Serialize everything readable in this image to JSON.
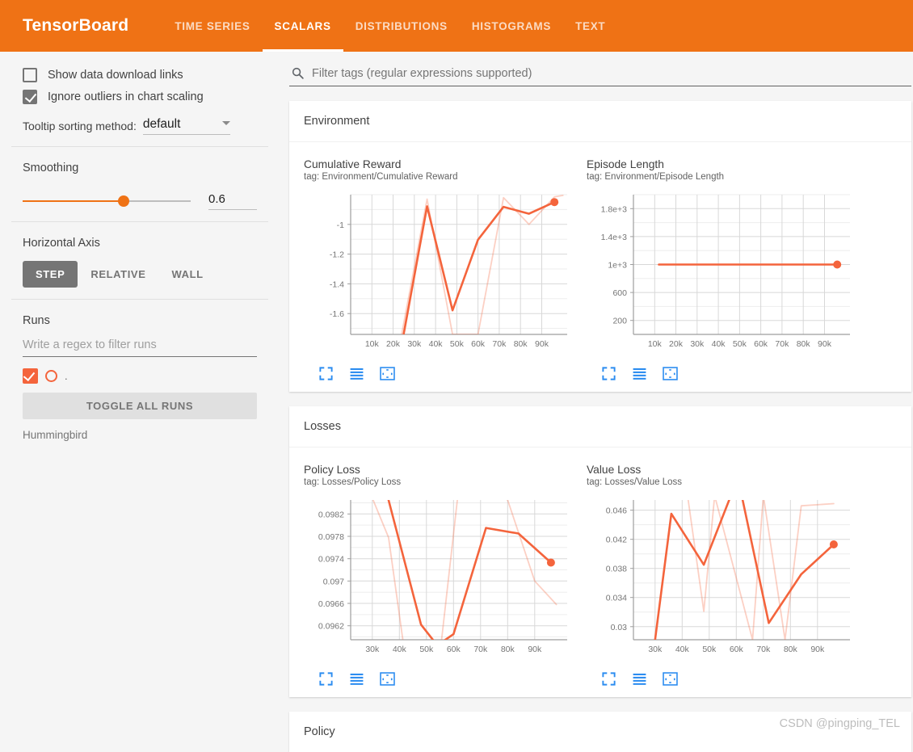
{
  "header": {
    "brand": "TensorBoard",
    "brand_color": "#ef7215",
    "tabs": [
      {
        "label": "TIME SERIES",
        "active": false
      },
      {
        "label": "SCALARS",
        "active": true
      },
      {
        "label": "DISTRIBUTIONS",
        "active": false
      },
      {
        "label": "HISTOGRAMS",
        "active": false
      },
      {
        "label": "TEXT",
        "active": false
      }
    ]
  },
  "sidebar": {
    "checkboxes": [
      {
        "label": "Show data download links",
        "checked": false
      },
      {
        "label": "Ignore outliers in chart scaling",
        "checked": true
      }
    ],
    "tooltip": {
      "label": "Tooltip sorting method:",
      "value": "default",
      "icon": "chevron-down-icon"
    },
    "smoothing": {
      "title": "Smoothing",
      "value": "0.6",
      "slider_percent": 60
    },
    "horizontal_axis": {
      "title": "Horizontal Axis",
      "options": [
        {
          "label": "STEP",
          "active": true
        },
        {
          "label": "RELATIVE",
          "active": false
        },
        {
          "label": "WALL",
          "active": false
        }
      ]
    },
    "runs": {
      "title": "Runs",
      "filter_placeholder": "Write a regex to filter runs",
      "run_color": "#f4643c",
      "dot_label": ".",
      "toggle_all_label": "TOGGLE ALL RUNS",
      "run_name": "Hummingbird"
    }
  },
  "main": {
    "tag_filter": {
      "placeholder": "Filter tags (regular expressions supported)",
      "icon": "search-icon"
    },
    "sections": [
      {
        "title": "Environment"
      },
      {
        "title": "Losses"
      },
      {
        "title": "Policy"
      }
    ],
    "chart_icons": [
      {
        "name": "expand-chart-icon",
        "title": "Fit domain to data"
      },
      {
        "name": "data-table-icon",
        "title": "Toggle data series"
      },
      {
        "name": "fit-domain-icon",
        "title": "Fullscreen"
      }
    ],
    "icon_color": "#2b8cf0"
  },
  "watermark": "CSDN @pingping_TEL",
  "chart_data": [
    {
      "type": "line",
      "title": "Cumulative Reward",
      "tag": "tag: Environment/Cumulative Reward",
      "xlabel": "",
      "ylabel": "",
      "grid": true,
      "legend": "none",
      "xlim": [
        0,
        102000
      ],
      "ylim": [
        -1.74,
        -0.8
      ],
      "xticks": [
        10000,
        20000,
        30000,
        40000,
        50000,
        60000,
        70000,
        80000,
        90000
      ],
      "xticklabels": [
        "10k",
        "20k",
        "30k",
        "40k",
        "50k",
        "60k",
        "70k",
        "80k",
        "90k"
      ],
      "yticks": [
        -1,
        -1.2,
        -1.4,
        -1.6
      ],
      "yticklabels": [
        "-1",
        "-1.2",
        "-1.4",
        "-1.6"
      ],
      "series": [
        {
          "name": "Hummingbird (smoothed)",
          "color": "#f4643c",
          "opacity": 1,
          "marker_last": true,
          "x": [
            25000,
            36000,
            48000,
            60000,
            72000,
            84000,
            96000
          ],
          "y": [
            -1.735,
            -0.878,
            -1.578,
            -1.103,
            -0.882,
            -0.928,
            -0.85
          ]
        },
        {
          "name": "Hummingbird (raw)",
          "color": "#f4643c",
          "opacity": 0.3,
          "marker_last": false,
          "x": [
            24000,
            36000,
            48000,
            60000,
            72000,
            84000,
            96000,
            100000
          ],
          "y": [
            -1.74,
            -0.83,
            -1.74,
            -1.74,
            -0.82,
            -1.0,
            -0.815,
            -0.805
          ]
        }
      ]
    },
    {
      "type": "line",
      "title": "Episode Length",
      "tag": "tag: Environment/Episode Length",
      "xlabel": "",
      "ylabel": "",
      "grid": true,
      "legend": "none",
      "xlim": [
        0,
        102000
      ],
      "ylim": [
        0,
        2000
      ],
      "xticks": [
        10000,
        20000,
        30000,
        40000,
        50000,
        60000,
        70000,
        80000,
        90000
      ],
      "xticklabels": [
        "10k",
        "20k",
        "30k",
        "40k",
        "50k",
        "60k",
        "70k",
        "80k",
        "90k"
      ],
      "yticks": [
        1800,
        1400,
        1000,
        600,
        200
      ],
      "yticklabels": [
        "1.8e+3",
        "1.4e+3",
        "1e+3",
        "600",
        "200"
      ],
      "series": [
        {
          "name": "Hummingbird (smoothed)",
          "color": "#f4643c",
          "opacity": 1,
          "marker_last": true,
          "x": [
            12000,
            24000,
            36000,
            48000,
            60000,
            72000,
            84000,
            96000
          ],
          "y": [
            1000,
            1000,
            1000,
            1000,
            1000,
            1000,
            1000,
            1000
          ]
        }
      ]
    },
    {
      "type": "line",
      "title": "Policy Loss",
      "tag": "tag: Losses/Policy Loss",
      "xlabel": "",
      "ylabel": "",
      "grid": true,
      "legend": "none",
      "xlim": [
        22000,
        102000
      ],
      "ylim": [
        0.09595,
        0.09845
      ],
      "xticks": [
        30000,
        40000,
        50000,
        60000,
        70000,
        80000,
        90000
      ],
      "xticklabels": [
        "30k",
        "40k",
        "50k",
        "60k",
        "70k",
        "80k",
        "90k"
      ],
      "yticks": [
        0.0982,
        0.0978,
        0.0974,
        0.097,
        0.0966,
        0.0962
      ],
      "yticklabels": [
        "0.0982",
        "0.0978",
        "0.0974",
        "0.097",
        "0.0966",
        "0.0962"
      ],
      "series": [
        {
          "name": "Hummingbird (smoothed)",
          "color": "#f4643c",
          "opacity": 1,
          "marker_last": true,
          "x": [
            34000,
            36000,
            48000,
            54000,
            60000,
            72000,
            84000,
            96000
          ],
          "y": [
            0.099,
            0.09845,
            0.09622,
            0.09585,
            0.09605,
            0.09795,
            0.09785,
            0.09733
          ]
        },
        {
          "name": "Hummingbird (raw)",
          "color": "#f4643c",
          "opacity": 0.3,
          "marker_last": false,
          "x": [
            29000,
            36000,
            42000,
            48000,
            55000,
            62000,
            70000,
            80000,
            90000,
            98000
          ],
          "y": [
            0.0986,
            0.09778,
            0.0957,
            0.0957,
            0.0957,
            0.0987,
            0.0987,
            0.09845,
            0.097,
            0.09658
          ]
        }
      ]
    },
    {
      "type": "line",
      "title": "Value Loss",
      "tag": "tag: Losses/Value Loss",
      "xlabel": "",
      "ylabel": "",
      "grid": true,
      "legend": "none",
      "xlim": [
        22000,
        102000
      ],
      "ylim": [
        0.0282,
        0.0474
      ],
      "xticks": [
        30000,
        40000,
        50000,
        60000,
        70000,
        80000,
        90000
      ],
      "xticklabels": [
        "30k",
        "40k",
        "50k",
        "60k",
        "70k",
        "80k",
        "90k"
      ],
      "yticks": [
        0.046,
        0.042,
        0.038,
        0.034,
        0.03
      ],
      "yticklabels": [
        "0.046",
        "0.042",
        "0.038",
        "0.034",
        "0.03"
      ],
      "series": [
        {
          "name": "Hummingbird (smoothed)",
          "color": "#f4643c",
          "opacity": 1,
          "marker_last": true,
          "x": [
            30000,
            36000,
            48000,
            58000,
            62000,
            72000,
            84000,
            96000
          ],
          "y": [
            0.0282,
            0.0455,
            0.0385,
            0.048,
            0.048,
            0.0305,
            0.0372,
            0.0413
          ]
        },
        {
          "name": "Hummingbird (raw)",
          "color": "#f4643c",
          "opacity": 0.3,
          "marker_last": false,
          "x": [
            42000,
            48000,
            52000,
            66000,
            70000,
            78000,
            84000,
            96000
          ],
          "y": [
            0.048,
            0.0321,
            0.048,
            0.0282,
            0.048,
            0.0282,
            0.0466,
            0.0469
          ]
        }
      ]
    }
  ]
}
